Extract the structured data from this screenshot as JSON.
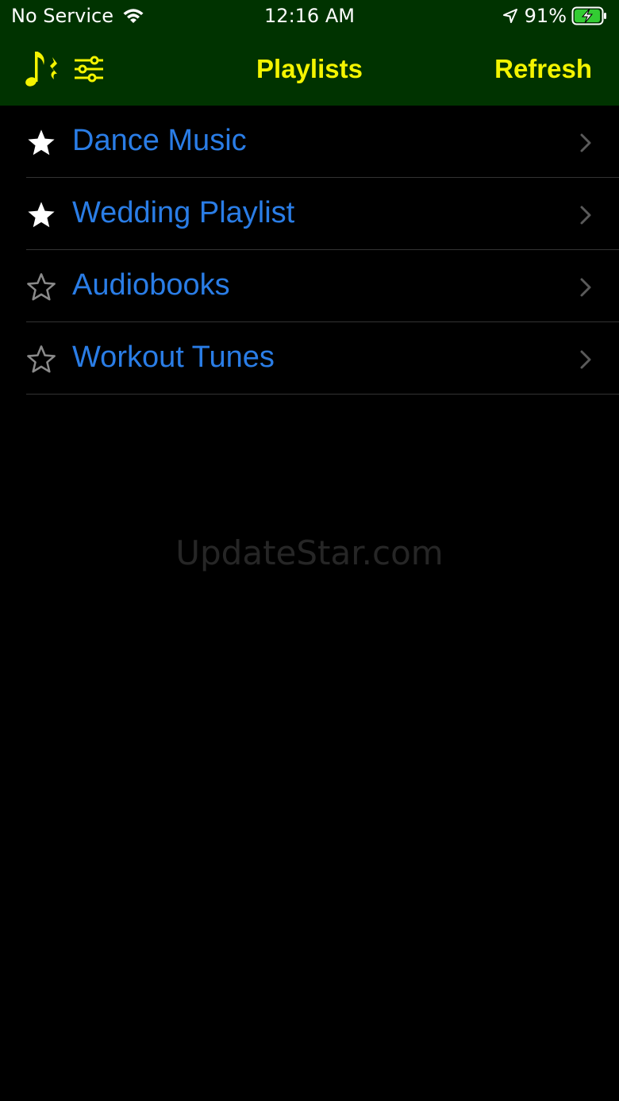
{
  "status_bar": {
    "carrier": "No Service",
    "time": "12:16 AM",
    "battery": "91%",
    "icons": [
      "wifi-icon",
      "location-arrow-icon",
      "battery-charging-icon"
    ]
  },
  "nav": {
    "title": "Playlists",
    "refresh_label": "Refresh",
    "icons": [
      "music-notes-icon",
      "sliders-icon"
    ],
    "accent_color": "#f4f400",
    "bar_color": "#003300"
  },
  "playlists": [
    {
      "name": "Dance Music",
      "favorite": true
    },
    {
      "name": "Wedding Playlist",
      "favorite": true
    },
    {
      "name": "Audiobooks",
      "favorite": false
    },
    {
      "name": "Workout Tunes",
      "favorite": false
    }
  ],
  "list_text_color": "#2a7de6",
  "watermark": "UpdateStar.com"
}
